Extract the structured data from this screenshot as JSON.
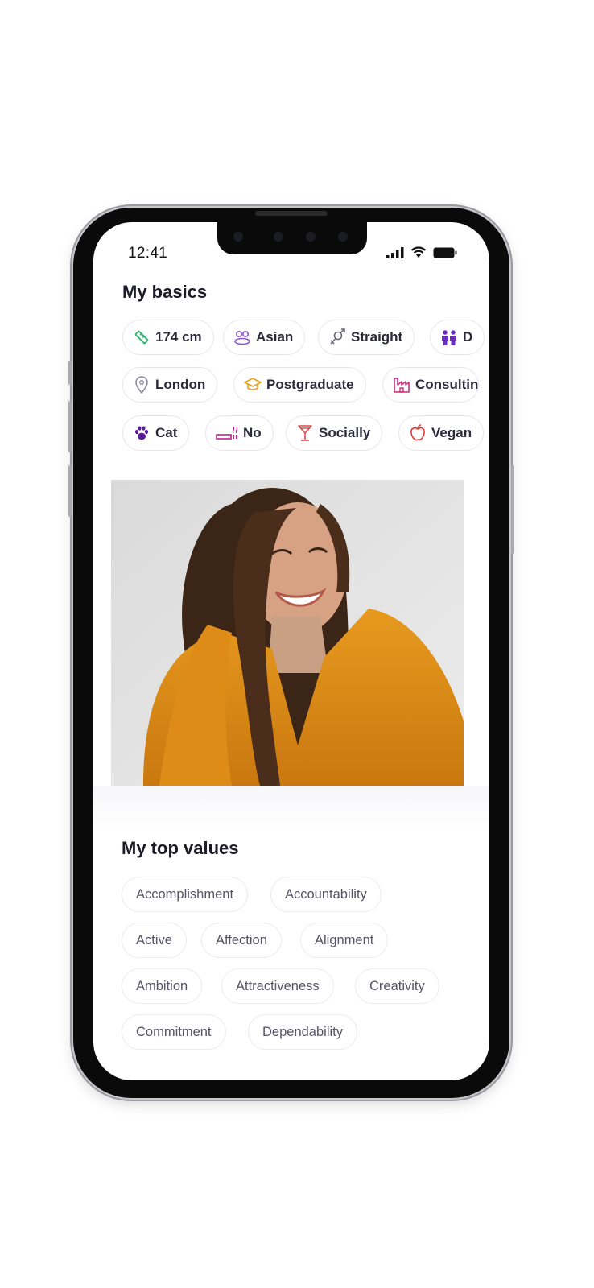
{
  "status_bar": {
    "time": "12:41"
  },
  "basics": {
    "title": "My basics",
    "chips": [
      {
        "label": "174 cm",
        "icon": "ruler-icon",
        "color": "#2fb36a"
      },
      {
        "label": "Asian",
        "icon": "people-icon",
        "color": "#8a57d6"
      },
      {
        "label": "Straight",
        "icon": "gender-icon",
        "color": "#666677"
      },
      {
        "label": "D",
        "icon": "family-icon",
        "color": "#6a2fbf"
      },
      {
        "label": "London",
        "icon": "location-pin-icon",
        "color": "#8a8aa0"
      },
      {
        "label": "Postgraduate",
        "icon": "graduation-cap-icon",
        "color": "#f0a020"
      },
      {
        "label": "Consultin",
        "icon": "industry-icon",
        "color": "#d02c7a"
      },
      {
        "label": "Cat",
        "icon": "paw-icon",
        "color": "#5a1a9a"
      },
      {
        "label": "No",
        "icon": "smoking-icon",
        "color": "#c0208a"
      },
      {
        "label": "Socially",
        "icon": "cocktail-icon",
        "color": "#e04a4a"
      },
      {
        "label": "Vegan",
        "icon": "apple-icon",
        "color": "#e03a3a"
      }
    ]
  },
  "values": {
    "title": "My top values",
    "chips": [
      "Accomplishment",
      "Accountability",
      "Active",
      "Affection",
      "Alignment",
      "Ambition",
      "Attractiveness",
      "Creativity",
      "Commitment",
      "Dependability"
    ]
  }
}
